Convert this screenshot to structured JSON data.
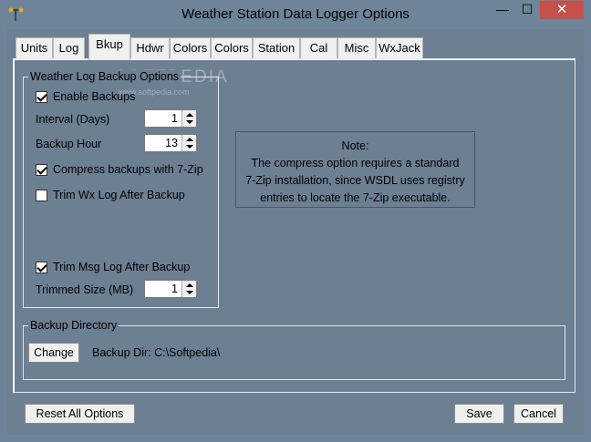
{
  "window": {
    "title": "Weather Station Data Logger Options",
    "min_glyph": "—",
    "max_glyph": "☐",
    "close_glyph": "✕"
  },
  "tabs": [
    "Units",
    "Log",
    "Bkup",
    "Hdwr",
    "Colors",
    "Colors",
    "Station",
    "Cal",
    "Misc",
    "WxJack"
  ],
  "active_tab": "Bkup",
  "watermark": {
    "main": "SOFTPEDIA",
    "sub": "www.softpedia.com"
  },
  "backup_options": {
    "title": "Weather Log Backup Options",
    "enable_backups": {
      "label": "Enable Backups",
      "checked": true
    },
    "interval": {
      "label": "Interval (Days)",
      "value": "1"
    },
    "backup_hour": {
      "label": "Backup Hour",
      "value": "13"
    },
    "compress": {
      "label": "Compress backups with 7-Zip",
      "checked": true
    },
    "trim_wx": {
      "label": "Trim Wx Log After Backup",
      "checked": false
    },
    "trim_msg": {
      "label": "Trim Msg Log After Backup",
      "checked": true
    },
    "trimmed_size": {
      "label": "Trimmed Size (MB)",
      "value": "1"
    }
  },
  "note": {
    "title": "Note:",
    "lines": [
      "The compress option requires a standard",
      "7-Zip installation, since WSDL uses registry",
      "entries to locate the 7-Zip executable."
    ]
  },
  "backup_directory": {
    "title": "Backup Directory",
    "change_label": "Change",
    "dir_text": "Backup Dir: C:\\Softpedia\\"
  },
  "footer": {
    "reset_label": "Reset All Options",
    "save_label": "Save",
    "cancel_label": "Cancel"
  }
}
